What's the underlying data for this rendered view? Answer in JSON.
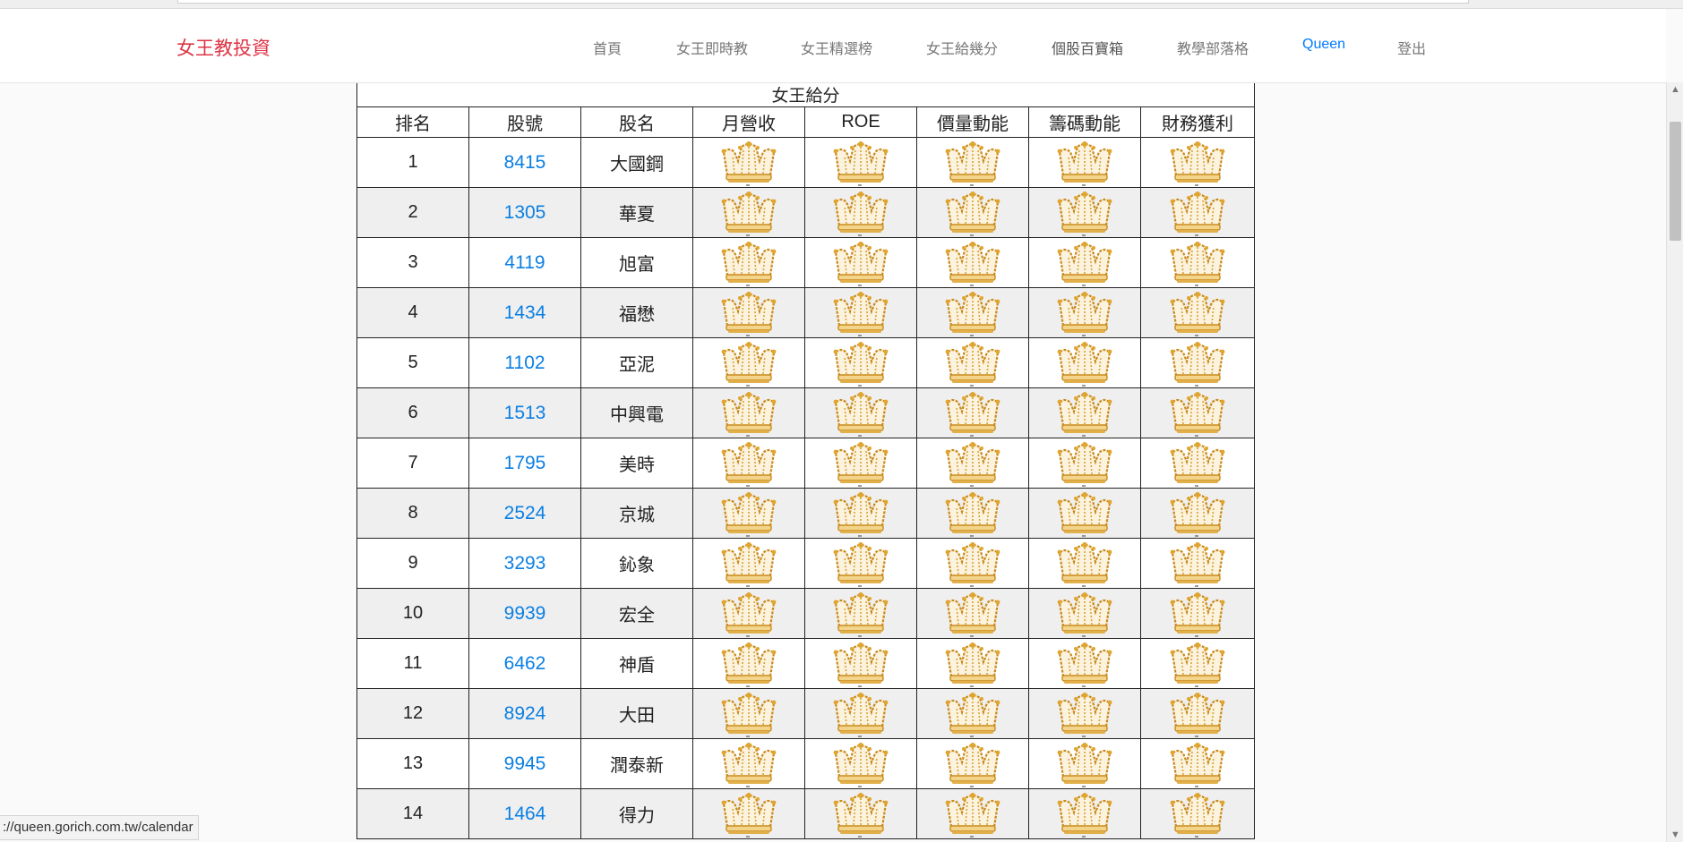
{
  "navbar": {
    "brand": "女王教投資",
    "items": [
      {
        "label": "首頁",
        "style": "muted"
      },
      {
        "label": "女王即時教",
        "style": "muted"
      },
      {
        "label": "女王精選榜",
        "style": "muted"
      },
      {
        "label": "女王給幾分",
        "style": "muted"
      },
      {
        "label": "個股百寶箱",
        "style": "dark"
      },
      {
        "label": "教學部落格",
        "style": "muted"
      },
      {
        "label": "Queen",
        "style": "active"
      },
      {
        "label": "登出",
        "style": "muted"
      }
    ]
  },
  "table": {
    "caption": "女王給分",
    "columns": [
      "排名",
      "股號",
      "股名",
      "月營收",
      "ROE",
      "價量動能",
      "籌碼動能",
      "財務獲利"
    ],
    "rows": [
      {
        "rank": "1",
        "code": "8415",
        "name": "大國鋼",
        "crowns": [
          "crown-icon",
          "crown-icon",
          "crown-icon",
          "crown-icon",
          "crown-icon"
        ]
      },
      {
        "rank": "2",
        "code": "1305",
        "name": "華夏",
        "crowns": [
          "crown-icon",
          "crown-icon",
          "crown-icon",
          "crown-icon",
          "crown-icon"
        ]
      },
      {
        "rank": "3",
        "code": "4119",
        "name": "旭富",
        "crowns": [
          "crown-icon",
          "crown-icon",
          "crown-icon",
          "crown-icon",
          "crown-icon"
        ]
      },
      {
        "rank": "4",
        "code": "1434",
        "name": "福懋",
        "crowns": [
          "crown-icon",
          "crown-icon",
          "crown-icon",
          "crown-icon",
          "crown-icon"
        ]
      },
      {
        "rank": "5",
        "code": "1102",
        "name": "亞泥",
        "crowns": [
          "crown-icon",
          "crown-icon",
          "crown-icon",
          "crown-icon",
          "crown-icon"
        ]
      },
      {
        "rank": "6",
        "code": "1513",
        "name": "中興電",
        "crowns": [
          "crown-icon",
          "crown-icon",
          "crown-icon",
          "crown-icon",
          "crown-icon"
        ]
      },
      {
        "rank": "7",
        "code": "1795",
        "name": "美時",
        "crowns": [
          "crown-icon",
          "crown-icon",
          "crown-icon",
          "crown-icon",
          "crown-icon"
        ]
      },
      {
        "rank": "8",
        "code": "2524",
        "name": "京城",
        "crowns": [
          "crown-icon",
          "crown-icon",
          "crown-icon",
          "crown-icon",
          "crown-icon"
        ]
      },
      {
        "rank": "9",
        "code": "3293",
        "name": "鈊象",
        "crowns": [
          "crown-icon",
          "crown-icon",
          "crown-icon",
          "crown-icon",
          "crown-icon"
        ]
      },
      {
        "rank": "10",
        "code": "9939",
        "name": "宏全",
        "crowns": [
          "crown-icon",
          "crown-icon",
          "crown-icon",
          "crown-icon",
          "crown-icon"
        ]
      },
      {
        "rank": "11",
        "code": "6462",
        "name": "神盾",
        "crowns": [
          "crown-icon",
          "crown-icon",
          "crown-icon",
          "crown-icon",
          "crown-icon"
        ]
      },
      {
        "rank": "12",
        "code": "8924",
        "name": "大田",
        "crowns": [
          "crown-icon",
          "crown-icon",
          "crown-icon",
          "crown-icon",
          "crown-icon"
        ]
      },
      {
        "rank": "13",
        "code": "9945",
        "name": "潤泰新",
        "crowns": [
          "crown-icon",
          "crown-icon",
          "crown-icon",
          "crown-icon",
          "crown-icon"
        ]
      },
      {
        "rank": "14",
        "code": "1464",
        "name": "得力",
        "crowns": [
          "crown-icon",
          "crown-icon",
          "crown-icon",
          "crown-icon",
          "crown-icon"
        ]
      }
    ]
  },
  "status_bar": {
    "url": "://queen.gorich.com.tw/calendar"
  },
  "colors": {
    "brand": "#dc3545",
    "link": "#0a7fe3",
    "nav_active": "#007bff",
    "row_alt": "#efefef",
    "crown_gold": "#d89a2a"
  }
}
